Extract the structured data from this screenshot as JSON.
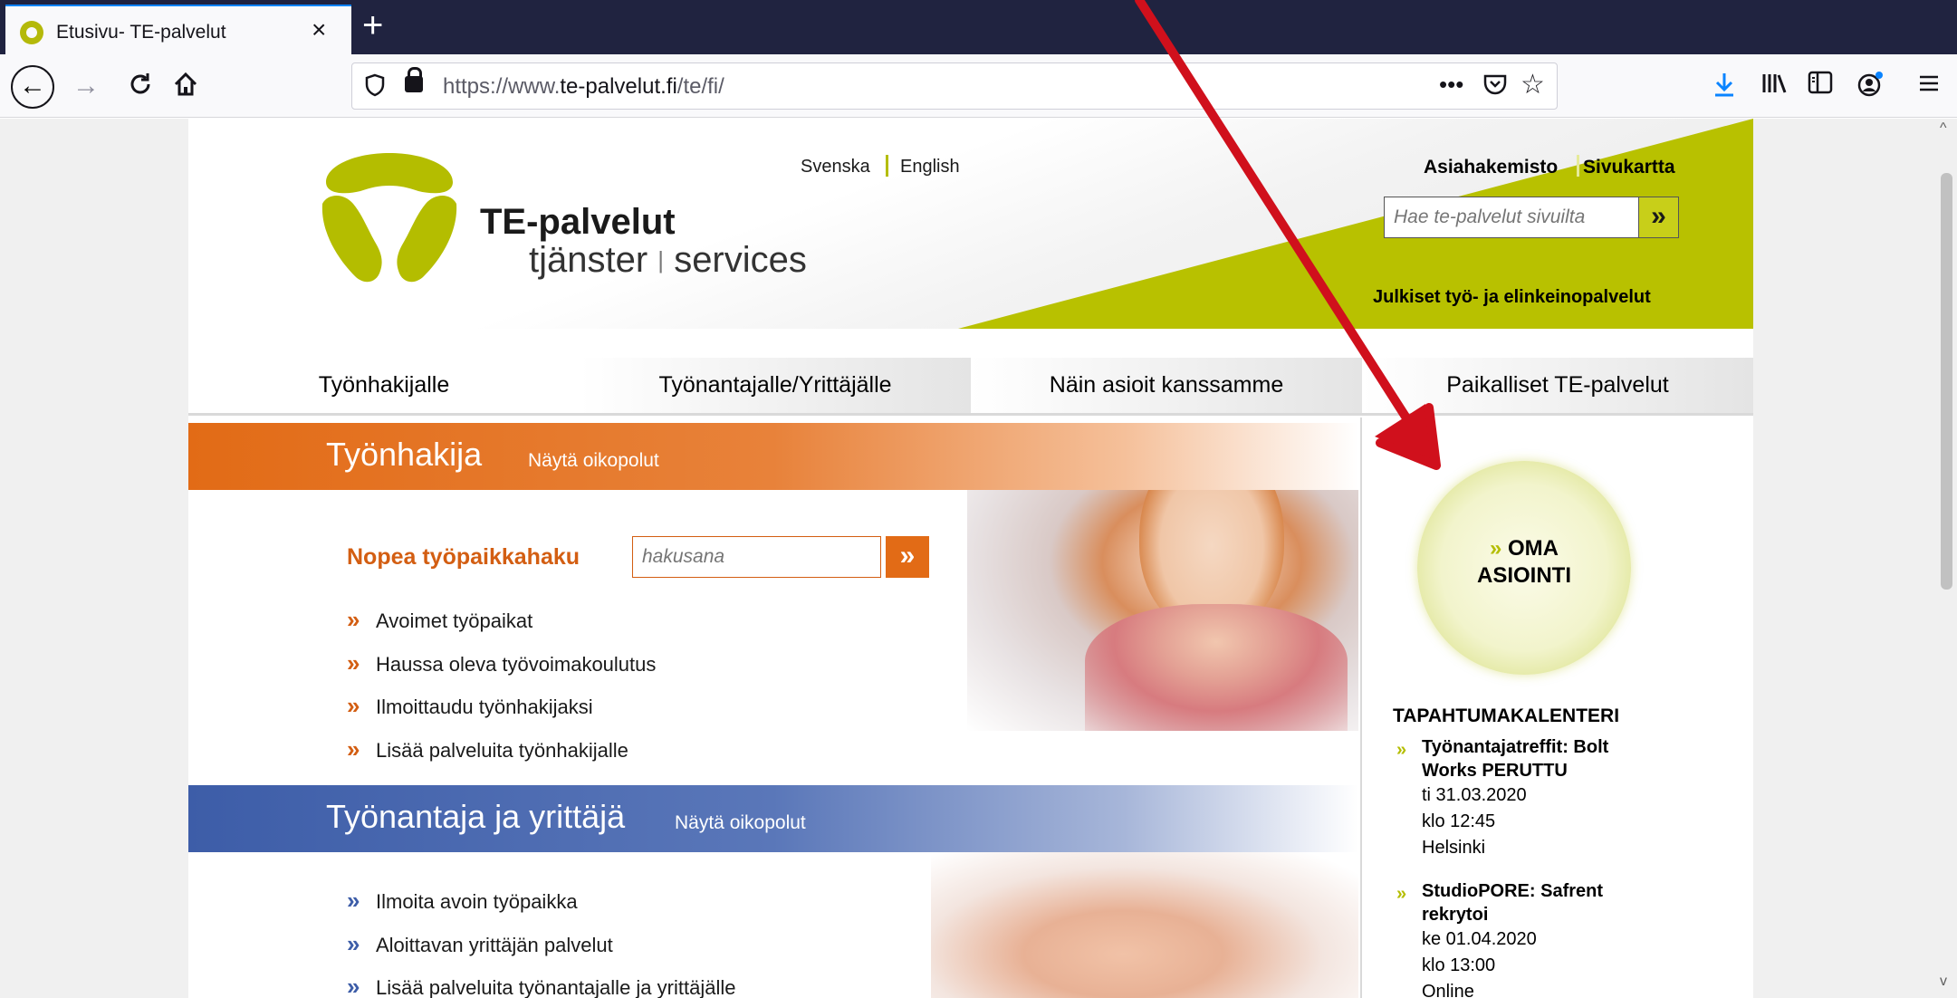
{
  "browser": {
    "tab_title": "Etusivu- TE-palvelut",
    "tab_close": "×",
    "new_tab": "+",
    "url_prefix": "https://www.",
    "url_domain": "te-palvelut.fi",
    "url_path": "/te/fi/",
    "page_actions": "•••",
    "icons": [
      "back-icon",
      "forward-icon",
      "reload-icon",
      "home-icon",
      "shield-icon",
      "lock-icon",
      "pocket-icon",
      "bookmark-star-icon",
      "download-icon",
      "library-icon",
      "sidebar-icon",
      "account-icon",
      "menu-icon"
    ]
  },
  "header": {
    "logo_name": "TE-palvelut",
    "logo_sub_1": "tjänster",
    "logo_sub_sep": "|",
    "logo_sub_2": "services",
    "lang_sv": "Svenska",
    "lang_en": "English",
    "link_directory": "Asiahakemisto",
    "link_sitemap": "Sivukartta",
    "search_placeholder": "Hae te-palvelut sivuilta",
    "search_button": "»",
    "tagline": "Julkiset työ- ja elinkeinopalvelut"
  },
  "mainnav": {
    "items": [
      "Työnhakijalle",
      "Työnantajalle/Yrittäjälle",
      "Näin asioit kanssamme",
      "Paikalliset TE-palvelut"
    ]
  },
  "jobseeker": {
    "title": "Työnhakija",
    "shortcut_link": "Näytä oikopolut",
    "quick_search_label": "Nopea työpaikkahaku",
    "quick_search_placeholder": "hakusana",
    "quick_search_button": "»",
    "links": [
      "Avoimet työpaikat",
      "Haussa oleva työvoimakoulutus",
      "Ilmoittaudu työnhakijaksi",
      "Lisää palveluita työnhakijalle"
    ]
  },
  "employer": {
    "title": "Työnantaja ja yrittäjä",
    "shortcut_link": "Näytä oikopolut",
    "links": [
      "Ilmoita avoin työpaikka",
      "Aloittavan yrittäjän palvelut",
      "Lisää palveluita työnantajalle ja yrittäjälle"
    ]
  },
  "sidebar": {
    "oma_line1": "OMA",
    "oma_line2": "ASIOINTI",
    "oma_chevron": "»",
    "calendar_title": "TAPAHTUMAKALENTERI",
    "events": [
      {
        "title_1": "Työnantajatreffit: Bolt",
        "title_2": "Works PERUTTU",
        "date": "ti 31.03.2020",
        "time": "klo 12:45",
        "place": "Helsinki"
      },
      {
        "title_1": "StudioPORE: Safrent",
        "title_2": "rekrytoi",
        "date": "ke 01.04.2020",
        "time": "klo 13:00",
        "place": "Online"
      }
    ]
  },
  "colors": {
    "brand_green": "#b4bd00",
    "orange": "#e26b16",
    "blue": "#3d5da8",
    "annotation_red": "#d0101c",
    "browser_dark": "#202340"
  }
}
